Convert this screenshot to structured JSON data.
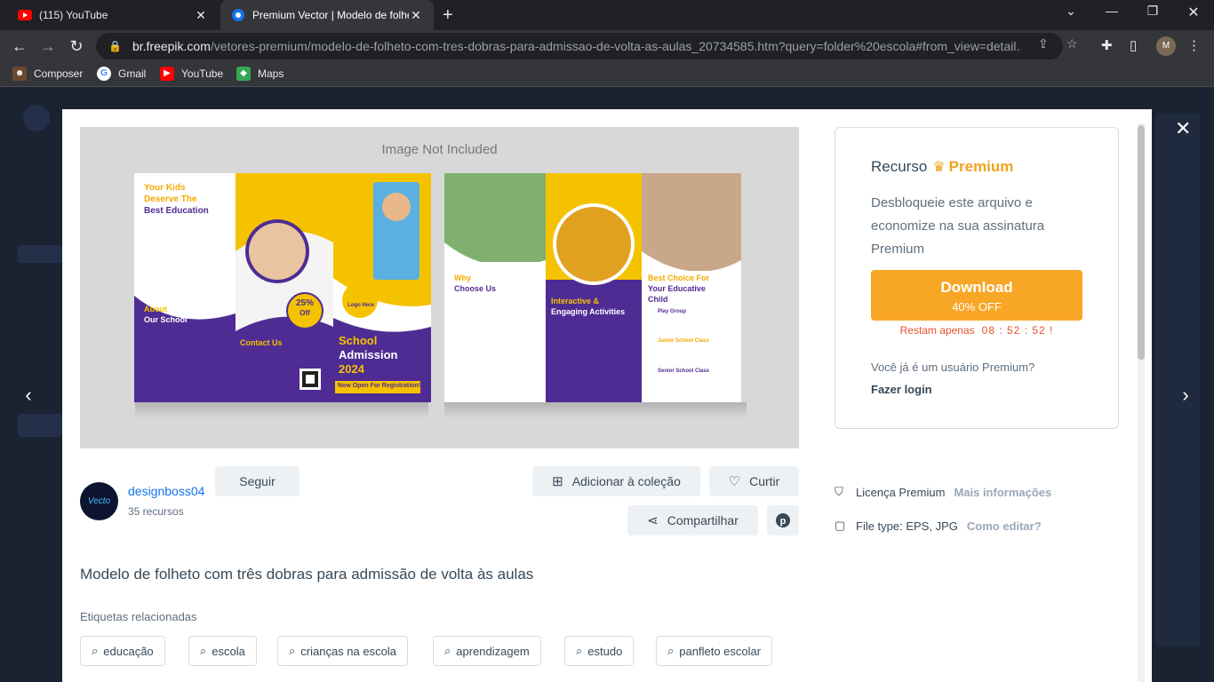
{
  "browser": {
    "tabs": [
      {
        "title": "(115) YouTube",
        "icon": "youtube-icon"
      },
      {
        "title": "Premium Vector | Modelo de folheto",
        "icon": "freepik-icon"
      }
    ],
    "url_domain": "br.freepik.com",
    "url_path": "/vetores-premium/modelo-de-folheto-com-tres-dobras-para-admissao-de-volta-as-aulas_20734585.htm?query=folder%20escola#from_view=detail...",
    "avatar_initial": "M",
    "bookmarks": [
      {
        "label": "Composer",
        "icon": "composer-icon"
      },
      {
        "label": "Gmail",
        "icon": "google-icon"
      },
      {
        "label": "YouTube",
        "icon": "youtube-icon"
      },
      {
        "label": "Maps",
        "icon": "maps-icon"
      }
    ]
  },
  "preview": {
    "watermark": "Image Not Included"
  },
  "premium": {
    "title_prefix": "Recurso",
    "title_highlight": "Premium",
    "description": "Desbloqueie este arquivo e economize na sua assinatura Premium",
    "download_label": "Download",
    "discount_label": "40% OFF",
    "countdown_label": "Restam apenas",
    "countdown_time": "08 : 52 : 52 !",
    "question": "Você já é um usuário Premium?",
    "login_label": "Fazer login"
  },
  "author": {
    "avatar_text": "Vecto",
    "name": "designboss04",
    "resources": "35 recursos",
    "follow_label": "Seguir"
  },
  "actions": {
    "add_collection": "Adicionar à coleção",
    "like": "Curtir",
    "share": "Compartilhar"
  },
  "license": {
    "label": "Licença Premium",
    "more_info": "Mais informações",
    "file_type": "File type: EPS, JPG",
    "how_edit": "Como editar?"
  },
  "item": {
    "title": "Modelo de folheto com três dobras para admissão de volta às aulas",
    "tags_label": "Etiquetas relacionadas",
    "tags": [
      "educação",
      "escola",
      "crianças na escola",
      "aprendizagem",
      "estudo",
      "panfleto escolar"
    ]
  },
  "brochure": {
    "p1_heading1": "Your Kids",
    "p1_heading2": "Deserve The",
    "p1_heading3": "Best Education",
    "p1_about1": "About",
    "p1_about2": "Our School",
    "p2_contact": "Contact Us",
    "p2_badge_top": "25%",
    "p2_badge_bottom": "Off",
    "p2_logo": "Logo Here",
    "p2_admission1": "School",
    "p2_admission2": "Admission",
    "p2_admission3": "2024",
    "p2_register": "Now Open For Registration!",
    "p4_why": "Why",
    "p4_choose": "Choose Us",
    "p5_heading1": "Interactive &",
    "p5_heading2": "Engaging Activities",
    "p6_heading1": "Best Choice For",
    "p6_heading2": "Your Educative",
    "p6_heading3": "Child",
    "p6_item1": "Play Group",
    "p6_item2": "Junior School Class",
    "p6_item3": "Senior School Class"
  }
}
